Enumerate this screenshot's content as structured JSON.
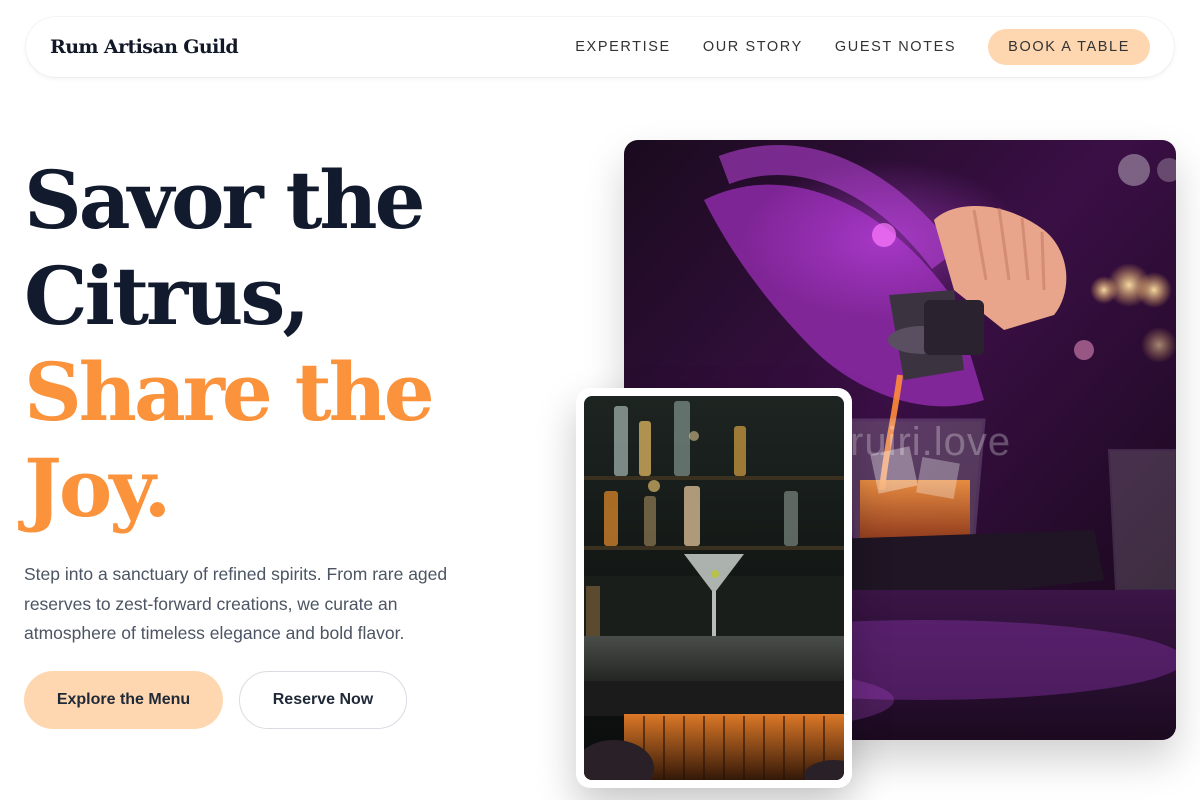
{
  "brand": {
    "name": "Rum Artisan Guild"
  },
  "nav": {
    "links": [
      "EXPERTISE",
      "OUR STORY",
      "GUEST NOTES"
    ],
    "cta_label": "BOOK A TABLE"
  },
  "hero": {
    "headline_line1": "Savor the",
    "headline_line2": "Citrus,",
    "headline_line3": "Share the",
    "headline_line4": "Joy.",
    "description": "Step into a sanctuary of refined spirits. From rare aged reserves to zest-forward creations, we curate an atmosphere of timeless elegance and bold flavor.",
    "primary_button": "Explore the Menu",
    "secondary_button": "Reserve Now"
  },
  "images": {
    "main": "bartender-pouring-drink-photo",
    "card": "martini-glass-bar-photo",
    "watermark": "ruiri.love"
  },
  "colors": {
    "accent": "#fb923c",
    "button_bg": "#fed7b0",
    "headline": "#121a2e",
    "body_text": "#4b5563"
  }
}
